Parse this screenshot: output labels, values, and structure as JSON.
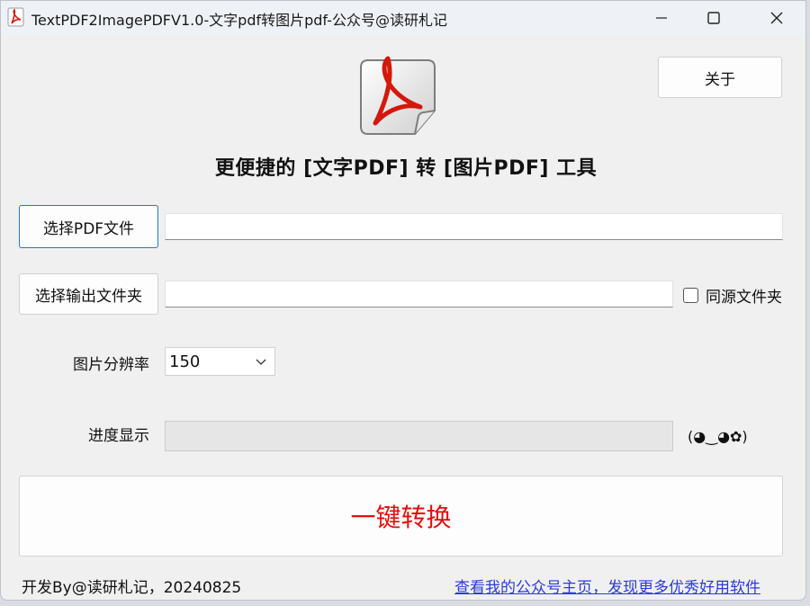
{
  "window": {
    "title": "TextPDF2ImagePDFV1.0-文字pdf转图片pdf-公众号@读研札记"
  },
  "header": {
    "about_label": "关于",
    "headline": "更便捷的 [文字PDF] 转 [图片PDF] 工具"
  },
  "form": {
    "select_pdf_label": "选择PDF文件",
    "pdf_path_value": "",
    "select_output_label": "选择输出文件夹",
    "output_path_value": "",
    "same_folder_label": "同源文件夹",
    "same_folder_checked": false,
    "resolution_label": "图片分辨率",
    "resolution_value": "150",
    "progress_label": "进度显示",
    "progress_value": 0,
    "emoticon": "(◕‿◕✿)"
  },
  "actions": {
    "convert_label": "一键转换"
  },
  "footer": {
    "credit": "开发By@读研札记，20240825",
    "link_text": "查看我的公众号主页，发现更多优秀好用软件"
  },
  "colors": {
    "accent_focus": "#2a76c4",
    "convert_text": "#e01010",
    "link": "#2c3ad8"
  }
}
